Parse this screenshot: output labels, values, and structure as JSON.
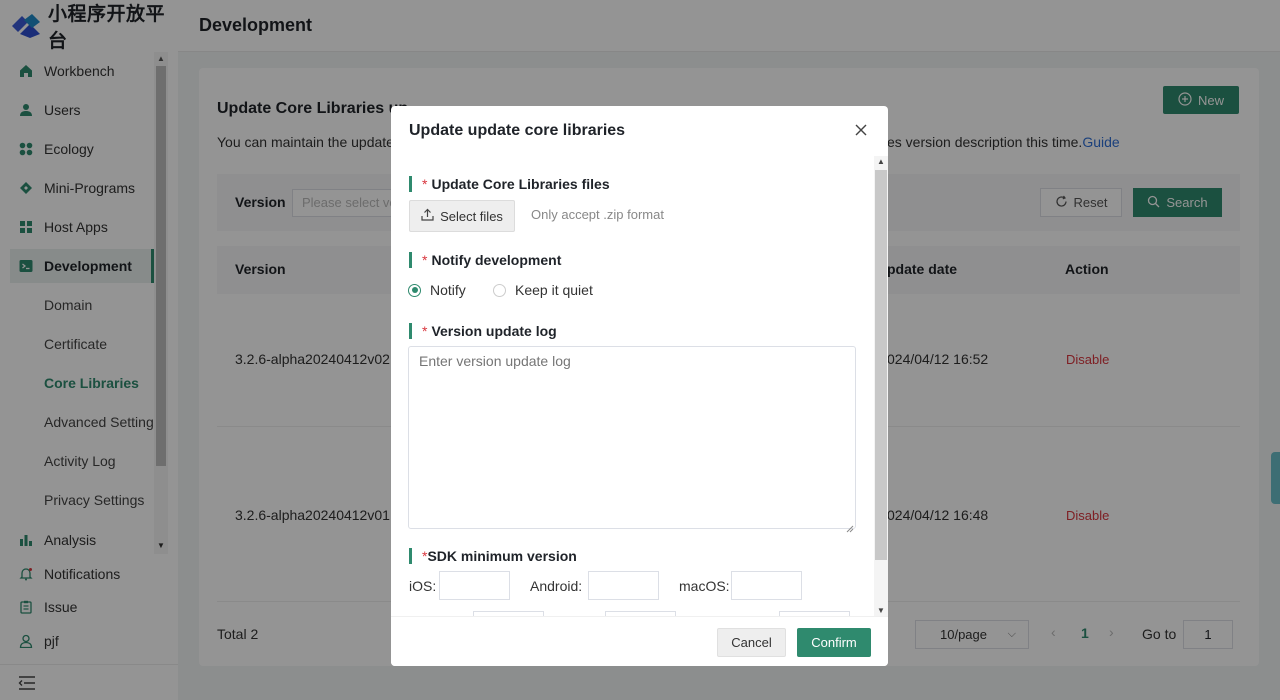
{
  "app": {
    "logo_text": "小程序开放平台"
  },
  "sidebar": {
    "items": [
      {
        "label": "Workbench",
        "icon": "home-icon"
      },
      {
        "label": "Users",
        "icon": "user-icon"
      },
      {
        "label": "Ecology",
        "icon": "grid-icon"
      },
      {
        "label": "Mini-Programs",
        "icon": "diamond-icon"
      },
      {
        "label": "Host Apps",
        "icon": "apps-icon"
      },
      {
        "label": "Development",
        "icon": "terminal-icon",
        "active": true
      }
    ],
    "subitems": [
      {
        "label": "Domain"
      },
      {
        "label": "Certificate"
      },
      {
        "label": "Core Libraries",
        "active": true
      },
      {
        "label": "Advanced Settings"
      },
      {
        "label": "Activity Log"
      },
      {
        "label": "Privacy Settings"
      }
    ],
    "lower_items": [
      {
        "label": "Analysis",
        "icon": "bar-chart-icon"
      },
      {
        "label": "Notifications",
        "icon": "bell-icon"
      },
      {
        "label": "Issue",
        "icon": "clipboard-icon"
      },
      {
        "label": "pjf",
        "icon": "person-icon"
      }
    ],
    "collapse_icon": "menu-collapse-icon"
  },
  "header": {
    "title": "Development"
  },
  "main": {
    "new_label": "New",
    "title": "Update Core Libraries up",
    "desc_left": "You can maintain the update",
    "desc_right": "es version description this time.",
    "guide_link": "Guide",
    "filter": {
      "label": "Version",
      "placeholder": "Please select ve",
      "reset_label": "Reset",
      "search_label": "Search"
    },
    "table": {
      "headers": {
        "version": "Version",
        "date": "pdate date",
        "action": "Action"
      },
      "rows": [
        {
          "version": "3.2.6-alpha20240412v02",
          "date": "024/04/12 16:52",
          "action": "Disable"
        },
        {
          "version": "3.2.6-alpha20240412v01",
          "date": "024/04/12 16:48",
          "action": "Disable"
        }
      ]
    },
    "pagination": {
      "total": "Total 2",
      "page_size": "10/page",
      "current_page": "1",
      "goto_label": "Go to",
      "goto_value": "1"
    }
  },
  "modal": {
    "title": "Update update core libraries",
    "sections": {
      "files": "Update Core Libraries files",
      "notify": "Notify development",
      "log": "Version update log",
      "sdk": "SDK minimum version"
    },
    "required_mark": "*",
    "select_files_label": "Select files",
    "files_hint": "Only accept .zip format",
    "notify_options": {
      "notify": "Notify",
      "quiet": "Keep it quiet"
    },
    "log_placeholder": "Enter version update log",
    "sdk_labels": {
      "ios": "iOS:",
      "android": "Android:",
      "macos": "macOS:"
    },
    "cancel_label": "Cancel",
    "confirm_label": "Confirm"
  },
  "colors": {
    "accent": "#2f8a6e",
    "danger": "#d9363e",
    "link": "#2f6fd6"
  }
}
